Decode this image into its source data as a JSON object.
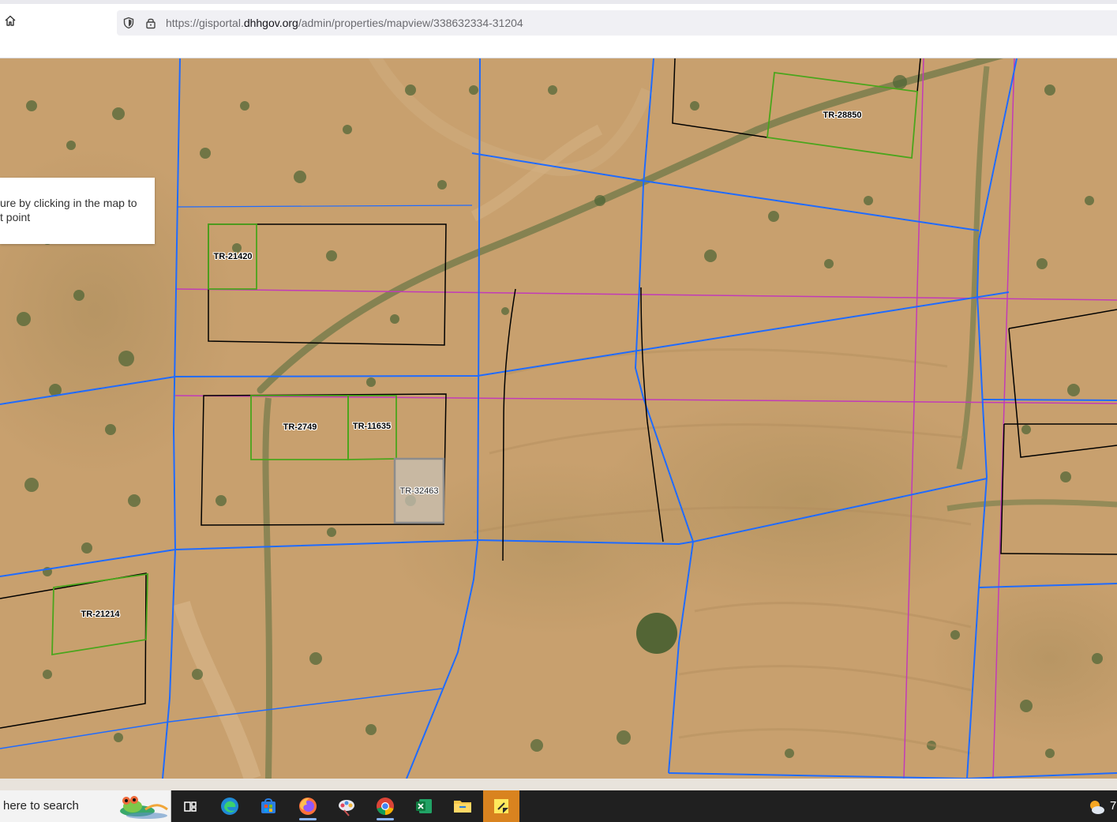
{
  "browser": {
    "url_prefix": "https://gisportal.",
    "url_host": "dhhgov.org",
    "url_path": "/admin/properties/mapview/338632334-31204",
    "icons": [
      "home-icon",
      "shield-icon",
      "lock-icon"
    ]
  },
  "map": {
    "tooltip_text": "ure by clicking in the map to\nt point",
    "parcels": [
      {
        "id": "tr-28850",
        "label": "TR-28850"
      },
      {
        "id": "tr-21420",
        "label": "TR-21420"
      },
      {
        "id": "tr-2749",
        "label": "TR-2749"
      },
      {
        "id": "tr-11635",
        "label": "TR-11635"
      },
      {
        "id": "tr-32463",
        "label": "TR-32463"
      },
      {
        "id": "tr-21214",
        "label": "TR-21214"
      }
    ],
    "colors": {
      "road_line": "#1f6bff",
      "boundary_line": "#c23bb8",
      "parcel_outline": "#000000",
      "parcel_selected": "#4aa51c",
      "parcel_gray": "#8c8c8c"
    }
  },
  "taskbar": {
    "search_text": "here to search",
    "apps": [
      "task-view-icon",
      "edge-icon",
      "store-icon",
      "firefox-icon",
      "snipping-icon",
      "chrome-icon",
      "excel-icon",
      "file-explorer-icon",
      "sticky-notes-icon"
    ],
    "weather_text": "7"
  }
}
